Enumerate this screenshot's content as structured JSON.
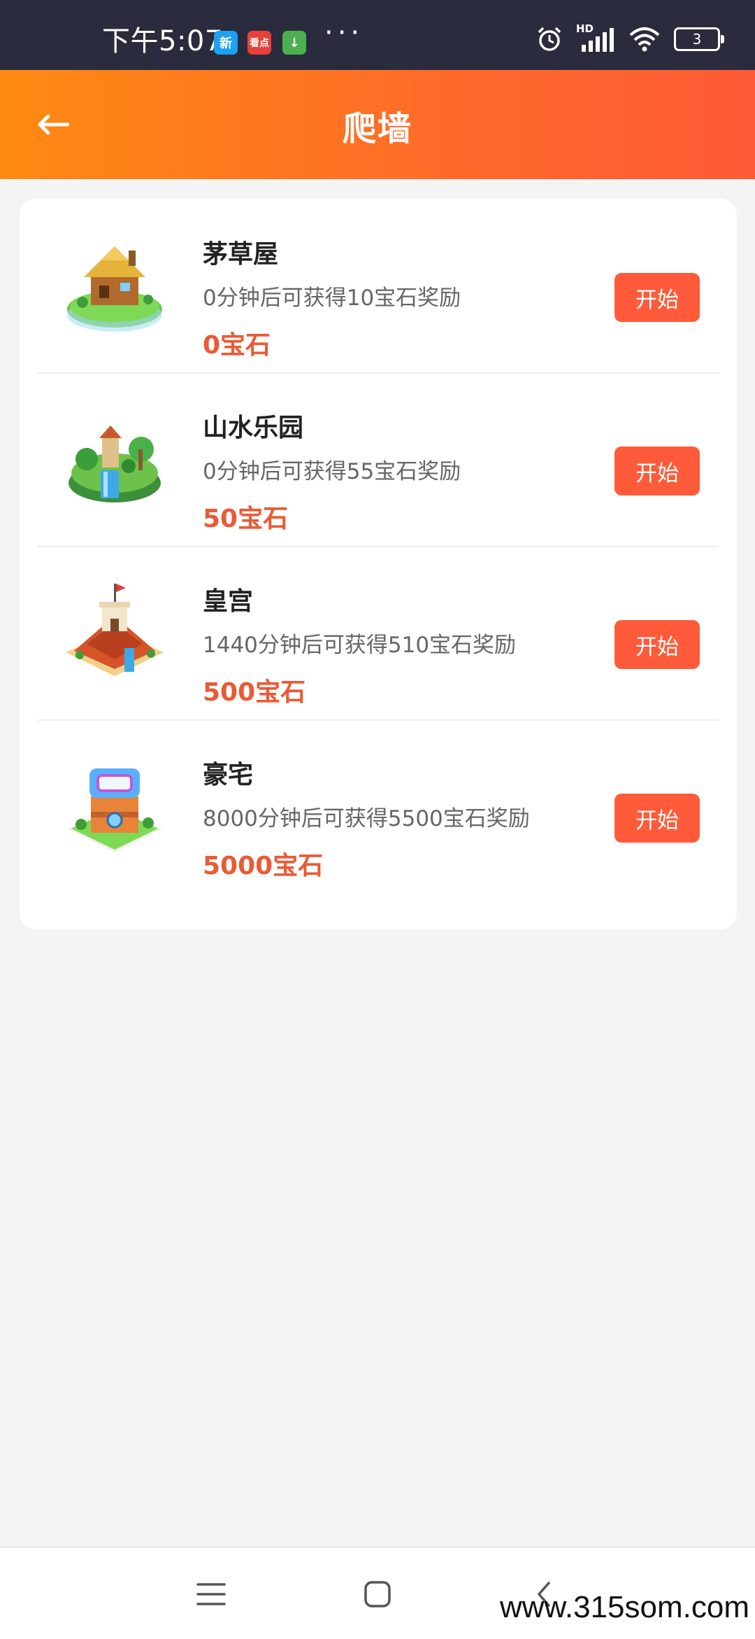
{
  "status_bar": {
    "time": "下午5:07",
    "apps": [
      {
        "icon": "news-app-icon",
        "label": "新",
        "color": "#1da1f2"
      },
      {
        "icon": "video-app-icon",
        "label": "看点",
        "color": "#e8413b"
      },
      {
        "icon": "download-app-icon",
        "label": "↓",
        "color": "#4caf50"
      }
    ],
    "more": "···",
    "network": "HD",
    "battery": "3"
  },
  "header": {
    "title": "爬墙",
    "back_icon": "back-arrow-icon"
  },
  "items": [
    {
      "name": "茅草屋",
      "desc": "0分钟后可获得10宝石奖励",
      "gems": "0宝石",
      "button": "开始",
      "thumb_icon": "thatched-house-icon"
    },
    {
      "name": "山水乐园",
      "desc": "0分钟后可获得55宝石奖励",
      "gems": "50宝石",
      "button": "开始",
      "thumb_icon": "waterfall-island-icon"
    },
    {
      "name": "皇宫",
      "desc": "1440分钟后可获得510宝石奖励",
      "gems": "500宝石",
      "button": "开始",
      "thumb_icon": "palace-icon"
    },
    {
      "name": "豪宅",
      "desc": "8000分钟后可获得5500宝石奖励",
      "gems": "5000宝石",
      "button": "开始",
      "thumb_icon": "mansion-icon"
    }
  ],
  "watermark": "www.315som.com",
  "colors": {
    "accent": "#ff5b3a",
    "gem_text": "#ea5a35",
    "header_start": "#ff8a12",
    "header_end": "#ff5a36"
  }
}
